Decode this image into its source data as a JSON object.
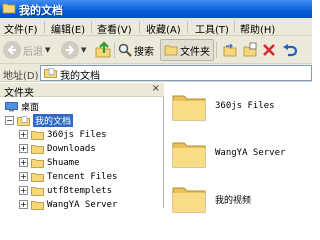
{
  "window": {
    "title": "我的文档"
  },
  "menu": [
    "文件(F)",
    "编辑(E)",
    "查看(V)",
    "收藏(A)",
    "工具(T)",
    "帮助(H)"
  ],
  "toolbar": {
    "back_label": "后退",
    "search_label": "搜索",
    "folders_label": "文件夹"
  },
  "address": {
    "label": "地址(D)",
    "value": "我的文档"
  },
  "folder_pane": {
    "header": "文件夹",
    "close_glyph": "×",
    "tree": [
      {
        "label": "桌面",
        "icon": "desktop-icon"
      },
      {
        "label": "我的文档",
        "expander": "−",
        "icon": "my-documents-icon",
        "selected": true
      },
      {
        "label": "360js Files",
        "expander": "+"
      },
      {
        "label": "Downloads",
        "expander": "+"
      },
      {
        "label": "Shuame",
        "expander": "+"
      },
      {
        "label": "Tencent Files",
        "expander": "+"
      },
      {
        "label": "utf8templets",
        "expander": "+"
      },
      {
        "label": "WangYA Server",
        "expander": "+"
      }
    ]
  },
  "content": {
    "items": [
      {
        "name": "360js Files"
      },
      {
        "name": "WangYA Server"
      },
      {
        "name": "我的视频"
      }
    ]
  },
  "colors": {
    "titlebar": "#0a5fd8",
    "chrome": "#ece9d8",
    "selection": "#316ac5",
    "folder": "#f6d77a"
  }
}
